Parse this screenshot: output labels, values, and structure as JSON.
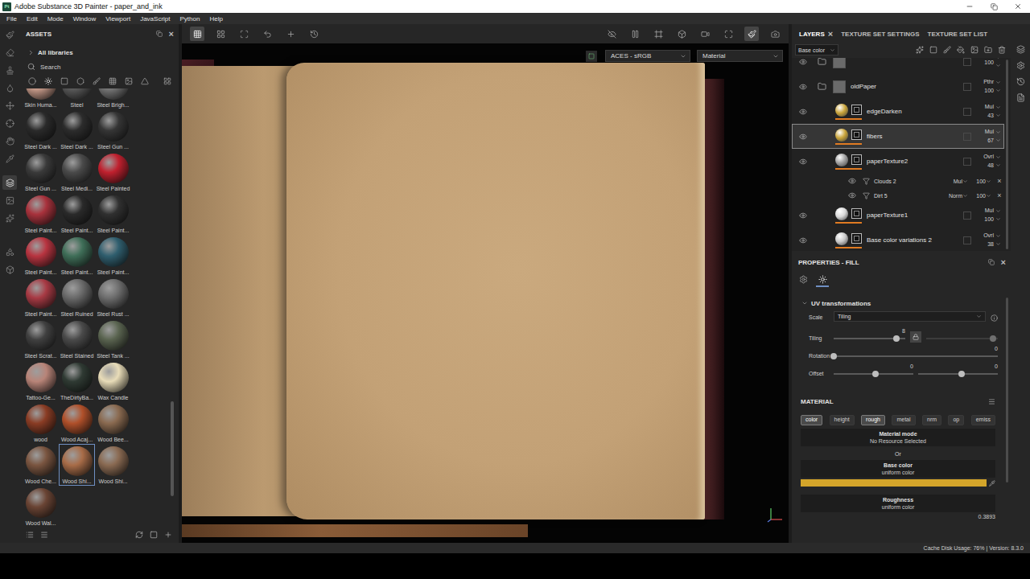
{
  "window": {
    "logo": "Pt",
    "title": "Adobe Substance 3D Painter - paper_and_ink"
  },
  "menu": [
    "File",
    "Edit",
    "Mode",
    "Window",
    "Viewport",
    "JavaScript",
    "Python",
    "Help"
  ],
  "toolstrip": [
    {
      "selected": false
    },
    {
      "selected": false
    },
    {
      "selected": false
    },
    {
      "selected": false
    },
    {
      "selected": false
    },
    {
      "selected": false
    },
    {
      "selected": false
    },
    {
      "selected": false
    },
    {
      "selected": true
    },
    {
      "selected": false
    },
    {
      "selected": false
    },
    {
      "selected": false
    },
    {
      "selected": false
    }
  ],
  "assets": {
    "title": "ASSETS",
    "close": "×",
    "library": "All libraries",
    "search": {
      "placeholder": "Search"
    },
    "filters": [
      {
        "selected": false
      },
      {
        "selected": true
      },
      {
        "selected": false
      },
      {
        "selected": false
      },
      {
        "selected": false
      },
      {
        "selected": false
      },
      {
        "selected": false
      },
      {
        "selected": false
      },
      {
        "selected": false
      }
    ],
    "scroll_level": 0.92,
    "items": [
      {
        "label": "Skin Huma...",
        "color": "#c89b8a",
        "selected": false
      },
      {
        "label": "Steel",
        "color": "#5a5a5a",
        "selected": false
      },
      {
        "label": "Steel Brigh...",
        "color": "#777777",
        "selected": false
      },
      {
        "label": "Steel Dark ...",
        "color": "#2a2a2a",
        "selected": false
      },
      {
        "label": "Steel Dark ...",
        "color": "#2c2c2c",
        "selected": false
      },
      {
        "label": "Steel Gun ...",
        "color": "#353535",
        "selected": false
      },
      {
        "label": "Steel Gun ...",
        "color": "#3a3a3a",
        "selected": false
      },
      {
        "label": "Steel Medi...",
        "color": "#4a4a4a",
        "selected": false
      },
      {
        "label": "Steel Painted",
        "color": "#c0202e",
        "selected": false
      },
      {
        "label": "Steel Paint...",
        "color": "#a8323c",
        "selected": false
      },
      {
        "label": "Steel Paint...",
        "color": "#2a2a2a",
        "selected": false
      },
      {
        "label": "Steel Paint...",
        "color": "#303030",
        "selected": false
      },
      {
        "label": "Steel Paint...",
        "color": "#b83440",
        "selected": false
      },
      {
        "label": "Steel Paint...",
        "color": "#3f6e58",
        "selected": false
      },
      {
        "label": "Steel Paint...",
        "color": "#2f5e6e",
        "selected": false
      },
      {
        "label": "Steel Paint...",
        "color": "#a83a44",
        "selected": false
      },
      {
        "label": "Steel Ruined",
        "color": "#6a6a6a",
        "selected": false
      },
      {
        "label": "Steel Rust ...",
        "color": "#6e6e6e",
        "selected": false
      },
      {
        "label": "Steel Scrat...",
        "color": "#404040",
        "selected": false
      },
      {
        "label": "Steel Stained",
        "color": "#4a4a4a",
        "selected": false
      },
      {
        "label": "Steel Tank ...",
        "color": "#5a6450",
        "selected": false
      },
      {
        "label": "Tattoo-Ge...",
        "color": "#b88478",
        "selected": false
      },
      {
        "label": "TheDirtyBa...",
        "color": "#2f3a33",
        "selected": false
      },
      {
        "label": "Wax Candle",
        "color": "#e8dcb8",
        "selected": false
      },
      {
        "label": "wood",
        "color": "#8a3c24",
        "selected": false
      },
      {
        "label": "Wood Acaj...",
        "color": "#b0502a",
        "selected": false
      },
      {
        "label": "Wood Bee...",
        "color": "#8a6a50",
        "selected": false
      },
      {
        "label": "Wood Che...",
        "color": "#7a5540",
        "selected": false
      },
      {
        "label": "Wood Shi...",
        "color": "#a86c48",
        "selected": true
      },
      {
        "label": "Wood Shi...",
        "color": "#8a6a52",
        "selected": false
      },
      {
        "label": "Wood Wal...",
        "color": "#6a4434",
        "selected": false
      }
    ]
  },
  "viewport": {
    "tools_left": [
      {
        "selected": true
      },
      {
        "selected": false
      },
      {
        "selected": false
      },
      {
        "selected": false
      },
      {
        "selected": false
      },
      {
        "selected": false
      }
    ],
    "tools_right": [
      {
        "selected": false
      },
      {
        "selected": false
      },
      {
        "selected": false
      },
      {
        "selected": false
      },
      {
        "selected": false
      },
      {
        "selected": false
      },
      {
        "selected": true
      },
      {
        "selected": false
      }
    ],
    "color_profile": "ACES - sRGB",
    "display": "Material"
  },
  "layers": {
    "tabs": [
      {
        "label": "LAYERS",
        "selected": true,
        "close": "×"
      },
      {
        "label": "TEXTURE SET SETTINGS",
        "selected": false,
        "close": ""
      },
      {
        "label": "TEXTURE SET LIST",
        "selected": false,
        "close": ""
      }
    ],
    "channel": "Base color",
    "rows": [
      {
        "kind": "folder",
        "name": "",
        "blend": "",
        "opacity": "100",
        "visible": true,
        "selected": false,
        "color": "#6a6a6a",
        "remove": ""
      },
      {
        "kind": "folder",
        "name": "oldPaper",
        "blend": "Pthr",
        "opacity": "100",
        "visible": true,
        "selected": false,
        "color": "#6a6a6a",
        "remove": ""
      },
      {
        "kind": "fill",
        "name": "edgeDarken",
        "blend": "Mul",
        "opacity": "43",
        "visible": true,
        "selected": false,
        "color": "#c9a43a",
        "remove": ""
      },
      {
        "kind": "fill",
        "name": "fibers",
        "blend": "Mul",
        "opacity": "67",
        "visible": true,
        "selected": true,
        "color": "#c9a43a",
        "remove": ""
      },
      {
        "kind": "fill",
        "name": "paperTexture2",
        "blend": "Ovrl",
        "opacity": "48",
        "visible": true,
        "selected": false,
        "color": "#a0a0a0",
        "remove": ""
      },
      {
        "kind": "effect",
        "name": "Clouds 2",
        "blend": "Mul",
        "opacity": "100",
        "visible": true,
        "selected": false,
        "color": "#a0a0a0",
        "remove": "×"
      },
      {
        "kind": "effect",
        "name": "Dirt 5",
        "blend": "Norm",
        "opacity": "100",
        "visible": true,
        "selected": false,
        "color": "#a0a0a0",
        "remove": "×"
      },
      {
        "kind": "fill",
        "name": "paperTexture1",
        "blend": "Mul",
        "opacity": "100",
        "visible": true,
        "selected": false,
        "color": "#d8d8d8",
        "remove": ""
      },
      {
        "kind": "fill",
        "name": "Base color variations 2",
        "blend": "Ovrl",
        "opacity": "38",
        "visible": true,
        "selected": false,
        "color": "#c8c8c8",
        "remove": ""
      }
    ]
  },
  "properties": {
    "title": "PROPERTIES - FILL",
    "close": "×",
    "tabs": [
      {
        "selected": false
      },
      {
        "selected": true
      }
    ],
    "section": {
      "title": "UV transformations",
      "expanded": true
    },
    "scale": {
      "label": "Scale",
      "value": "Tiling"
    },
    "tiling": {
      "label": "Tiling",
      "value": "8",
      "levels": [
        0.88,
        0.93
      ],
      "locked": true
    },
    "rotation": {
      "label": "Rotation",
      "value": "0",
      "level": 0
    },
    "offset": {
      "label": "Offset",
      "values": [
        "0",
        "0"
      ],
      "levels": [
        0.53,
        0.55
      ]
    },
    "material": {
      "title": "MATERIAL",
      "channels": [
        {
          "label": "color",
          "selected": true
        },
        {
          "label": "height",
          "selected": false
        },
        {
          "label": "rough",
          "selected": true
        },
        {
          "label": "metal",
          "selected": false
        },
        {
          "label": "nrm",
          "selected": false
        },
        {
          "label": "op",
          "selected": false
        },
        {
          "label": "emiss",
          "selected": false
        }
      ],
      "mode_label": "Material mode",
      "mode_value": "No Resource Selected",
      "or": "Or",
      "base_color": {
        "label": "Base color",
        "sub": "uniform color",
        "color": "#d4a52a"
      },
      "roughness": {
        "label": "Roughness",
        "sub": "uniform color",
        "value": "0.3893"
      }
    }
  },
  "status_bar": "Cache Disk Usage: 76% | Version: 8.3.0"
}
